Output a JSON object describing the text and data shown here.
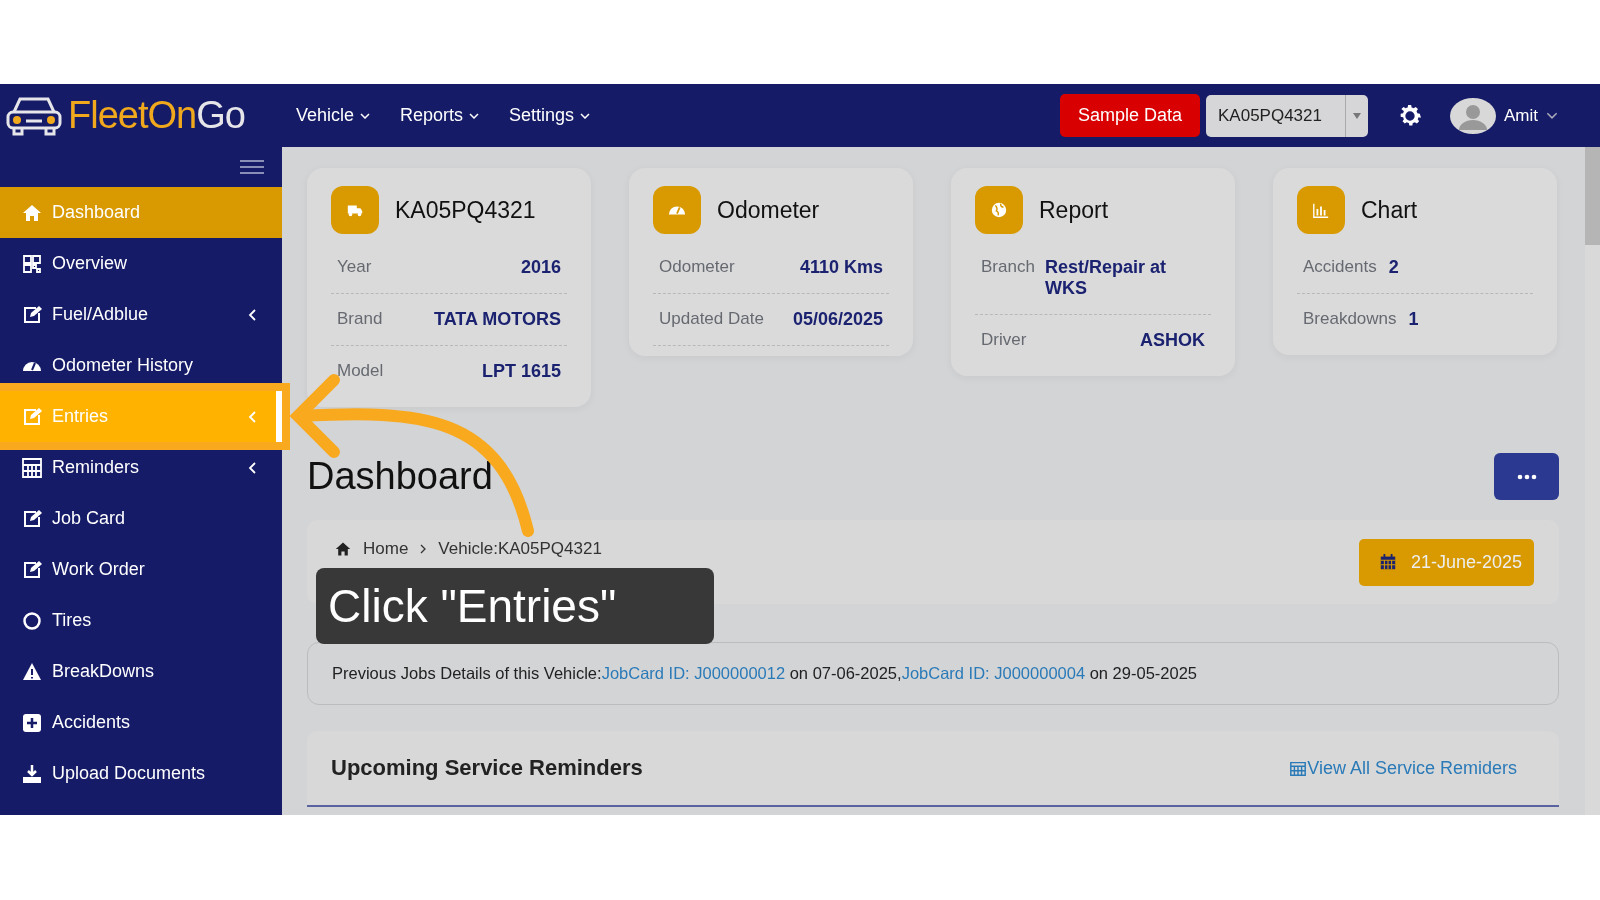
{
  "header": {
    "logo": [
      {
        "text": "FleetOn",
        "color": "#f0a91c"
      },
      {
        "text": "Go",
        "color": "#e6e6ea"
      }
    ],
    "menu": [
      {
        "label": "Vehicle"
      },
      {
        "label": "Reports"
      },
      {
        "label": "Settings"
      }
    ],
    "sample_button": "Sample Data",
    "vehicle_select": {
      "value": "KA05PQ4321"
    },
    "user": {
      "name": "Amit"
    }
  },
  "sidebar": {
    "items": [
      {
        "label": "Dashboard",
        "selected": true,
        "highlighted": false,
        "submenu": false
      },
      {
        "label": "Overview",
        "selected": false,
        "highlighted": false,
        "submenu": false
      },
      {
        "label": "Fuel/Adblue",
        "selected": false,
        "highlighted": false,
        "submenu": true
      },
      {
        "label": "Odometer History",
        "selected": false,
        "highlighted": false,
        "submenu": false
      },
      {
        "label": "Entries",
        "selected": false,
        "highlighted": true,
        "submenu": true
      },
      {
        "label": "Reminders",
        "selected": false,
        "highlighted": false,
        "submenu": true
      },
      {
        "label": "Job Card",
        "selected": false,
        "highlighted": false,
        "submenu": false
      },
      {
        "label": "Work Order",
        "selected": false,
        "highlighted": false,
        "submenu": false
      },
      {
        "label": "Tires",
        "selected": false,
        "highlighted": false,
        "submenu": false
      },
      {
        "label": "BreakDowns",
        "selected": false,
        "highlighted": false,
        "submenu": false
      },
      {
        "label": "Accidents",
        "selected": false,
        "highlighted": false,
        "submenu": false
      },
      {
        "label": "Upload Documents",
        "selected": false,
        "highlighted": false,
        "submenu": false
      }
    ]
  },
  "cards": [
    {
      "title": "KA05PQ4321",
      "rows": [
        {
          "label": "Year",
          "value": "2016"
        },
        {
          "label": "Brand",
          "value": "TATA MOTORS"
        },
        {
          "label": "Model",
          "value": "LPT 1615"
        }
      ]
    },
    {
      "title": "Odometer",
      "rows": [
        {
          "label": "Odometer",
          "value": "4110 Kms"
        },
        {
          "label": "Updated Date",
          "value": "05/06/2025"
        }
      ]
    },
    {
      "title": "Report",
      "rows": [
        {
          "label": "Branch",
          "value": "Rest/Repair at WKS"
        },
        {
          "label": "Driver",
          "value": "ASHOK"
        }
      ]
    },
    {
      "title": "Chart",
      "rows": [
        {
          "label": "Accidents",
          "value": "2"
        },
        {
          "label": "Breakdowns",
          "value": "1"
        }
      ]
    }
  ],
  "page_title": "Dashboard",
  "breadcrumb": [
    "Home",
    "Vehicle:KA05PQ4321"
  ],
  "date_button": "21-June-2025",
  "jobs": {
    "lead": "Previous Jobs Details of this Vehicle:",
    "entries": [
      {
        "link": "JobCard ID: J000000012",
        "date": "on 07-06-2025,"
      },
      {
        "link": "JobCard ID: J000000004",
        "date": "on 29-05-2025"
      }
    ]
  },
  "reminders": {
    "title": "Upcoming Service Reminders",
    "link": "View All Service Remiders"
  },
  "tutorial": {
    "tooltip": "Click \"Entries\""
  }
}
